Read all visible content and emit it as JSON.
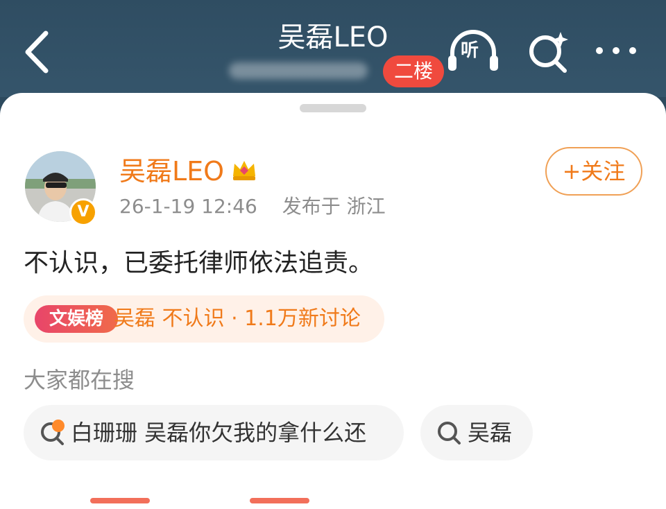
{
  "header": {
    "title": "吴磊LEO",
    "floor_badge": "二楼",
    "listen_label": "听"
  },
  "post": {
    "author": "吴磊LEO",
    "verified_mark": "V",
    "timestamp": "26-1-19 12:46",
    "location": "发布于 浙江",
    "follow_label": "+关注",
    "content": "不认识，已委托律师依法追责。"
  },
  "topic": {
    "tag": "文娱榜",
    "text": "吴磊 不认识 · 1.1万新讨论"
  },
  "search_section": {
    "label": "大家都在搜",
    "chips": [
      {
        "text": "白珊珊 吴磊你欠我的拿什么还",
        "icon": "hot-search-icon"
      },
      {
        "text": "吴磊",
        "icon": "search-icon"
      }
    ]
  },
  "colors": {
    "header_bg": "#2f4d62",
    "accent_orange": "#f07a1a",
    "badge_red": "#f04a3e",
    "topic_pill_bg": "#fff1e8"
  }
}
